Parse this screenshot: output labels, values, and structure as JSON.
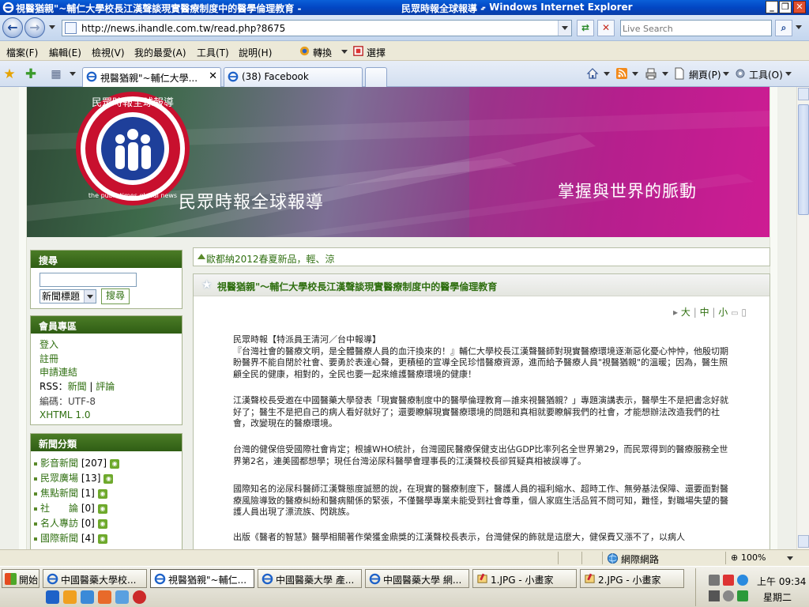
{
  "window": {
    "title": "視醫猶親\"~輔仁大學校長江漢聲談現實醫療制度中的醫學倫理教育 -",
    "brand": "民眾時報全球報導 -",
    "app": "- Windows Internet Explorer"
  },
  "address": {
    "url": "http://news.ihandle.com.tw/read.php?8675",
    "search_placeholder": "Live Search"
  },
  "menu": {
    "items": [
      "檔案(F)",
      "編輯(E)",
      "檢視(V)",
      "我的最愛(A)",
      "工具(T)",
      "說明(H)"
    ],
    "convert": "轉換",
    "select": "選擇"
  },
  "tabs": [
    {
      "label": "視醫猶親\"~輔仁大學..."
    },
    {
      "label": "(38) Facebook"
    }
  ],
  "commands": {
    "page": "網頁(P)",
    "tools": "工具(O)"
  },
  "banner": {
    "logo_text": "民眾時報全球報導",
    "logo_en": "the publictimes global news",
    "site_name": "民眾時報全球報導",
    "slogan": "掌握與世界的脈動"
  },
  "sidebar": {
    "search_title": "搜尋",
    "select_value": "新聞標題",
    "search_button": "搜尋",
    "member_title": "會員專區",
    "login": "登入",
    "register": "註冊",
    "apply_link": "申請連結",
    "rss_label": "RSS：",
    "rss_news": "新聞",
    "rss_sep": "|",
    "rss_comment": "評論",
    "encoding": "編碼：UTF-8",
    "xhtml": "XHTML 1.0",
    "category_title": "新聞分類",
    "categories": [
      {
        "name": "影音新聞",
        "count": "[207]"
      },
      {
        "name": "民眾廣場",
        "count": "[13]"
      },
      {
        "name": "焦點新聞",
        "count": "[1]"
      },
      {
        "name": "社　　論",
        "count": "[0]"
      },
      {
        "name": "名人專訪",
        "count": "[0]"
      },
      {
        "name": "國際新聞",
        "count": "[4]"
      }
    ]
  },
  "notice": "歐都納2012春夏新品，輕、涼",
  "article": {
    "title": "視醫猶親\"～輔仁大學校長江漢聲談現實醫療制度中的醫學倫理教育",
    "size_large": "大",
    "size_mid": "中",
    "size_small": "小",
    "size_sep": "|",
    "paragraphs": [
      "民眾時報【特派員王清河／台中報導】\n『台灣社會的醫療文明，是全體醫療人員的血汗換來的！』輔仁大學校長江漢聲醫師對現實醫療環境逐漸惡化憂心忡忡，他殷切期盼醫界不能自閉於社會、要勇於表達心聲，更積極的宣導全民珍惜醫療資源，進而給予醫療人員\"視醫猶親\"的溫暖；因為，醫生照顧全民的健康，相對的，全民也要一起來維護醫療環境的健康！",
      "江漢聲校長受邀在中國醫藥大學發表「現實醫療制度中的醫學倫理教育—誰來視醫猶親？」專題演講表示，醫學生不是把書念好就好了；醫生不是把自己的病人看好就好了；還要瞭解現實醫療環境的問題和真相就要瞭解我們的社會，才能想辦法改造我們的社會，改變現在的醫療環境。",
      "台灣的健保倍受國際社會肯定；根據WHO統計，台灣國民醫療保健支出佔GDP比率列名全世界第29，而民眾得到的醫療服務全世界第2名，連美國都想學；現任台灣泌尿科醫學會理事長的江漢聲校長卻質疑真相被誤導了。",
      "國際知名的泌尿科醫師江漢聲態度誠懇的說，在現實的醫療制度下，醫護人員的福利縮水、超時工作、無勞基法保障、還要面對醫療風險導致的醫療糾紛和醫病關係的緊張，不僅醫學專業未能受到社會尊重，個人家庭生活品質不問可知，難怪，對職場失望的醫護人員出現了漂流族、閃跳族。",
      "出版《醫者的智慧》醫學相關著作榮獲金鼎獎的江漢聲校長表示，台灣健保的飾就是這麼大，健保費又漲不了，以病人"
    ]
  },
  "status": {
    "zone": "網際網路",
    "zoom": "100%"
  },
  "taskbar": {
    "start": "開始",
    "tasks": [
      "中國醫藥大學校...",
      "視醫猶親\"~輔仁...",
      "中國醫藥大學 產...",
      "中國醫藥大學 網...",
      "1.JPG - 小畫家",
      "2.JPG - 小畫家"
    ],
    "time": "上午 09:34",
    "day": "星期二"
  },
  "colors": {
    "accent_green": "#2f6f10",
    "header_green": "#3d6d1d",
    "ie_blue": "#0a5fd8"
  }
}
